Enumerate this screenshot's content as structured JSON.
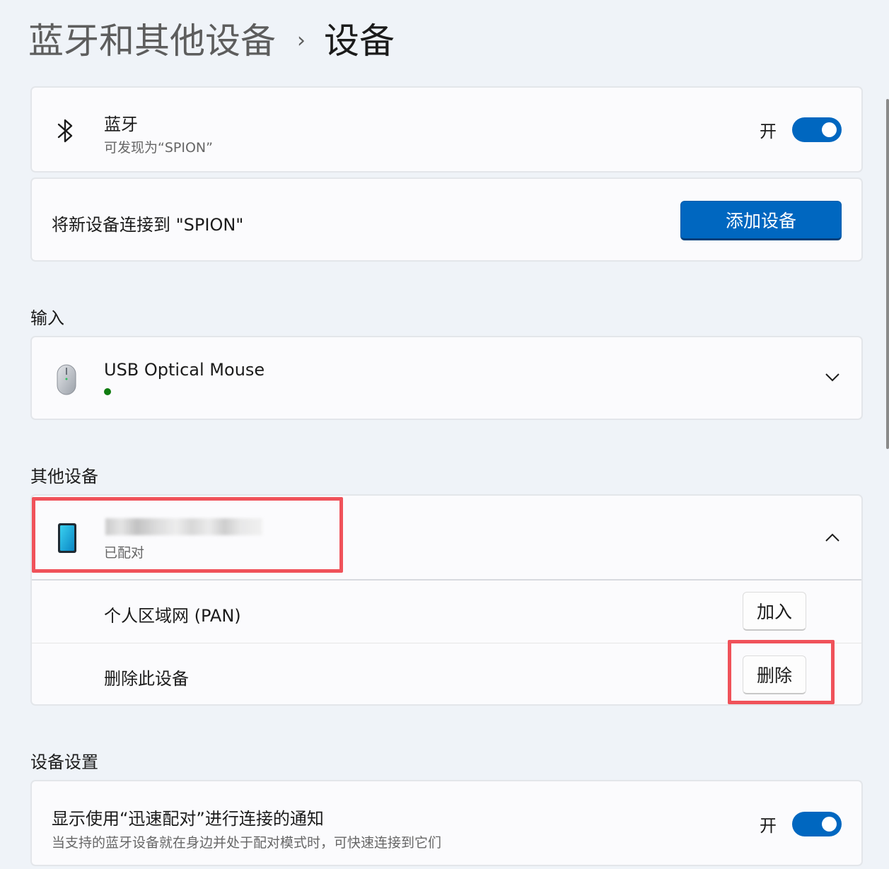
{
  "breadcrumb": {
    "parent": "蓝牙和其他设备",
    "separator": "›",
    "current": "设备"
  },
  "bluetooth": {
    "title": "蓝牙",
    "subtitle": "可发现为“SPION”",
    "toggle_label": "开",
    "icon": "bluetooth-icon"
  },
  "add_device": {
    "label": "将新设备连接到 \"SPION\"",
    "button_label": "添加设备"
  },
  "input_section": {
    "header": "输入",
    "devices": [
      {
        "name": "USB Optical Mouse",
        "status_color": "#107c10",
        "icon": "mouse-icon"
      }
    ]
  },
  "other_section": {
    "header": "其他设备",
    "device": {
      "name": "",
      "status": "已配对",
      "icon": "phone-icon"
    },
    "options": [
      {
        "label": "个人区域网 (PAN)",
        "button": "加入"
      },
      {
        "label": "删除此设备",
        "button": "删除"
      }
    ]
  },
  "settings_section": {
    "header": "设备设置",
    "swift_pair": {
      "title": "显示使用“迅速配对”进行连接的通知",
      "subtitle": "当支持的蓝牙设备就在身边并处于配对模式时，可快速连接到它们",
      "toggle_label": "开"
    }
  },
  "colors": {
    "accent": "#0067c0",
    "highlight": "#f0525a",
    "background": "#eff3f8"
  }
}
